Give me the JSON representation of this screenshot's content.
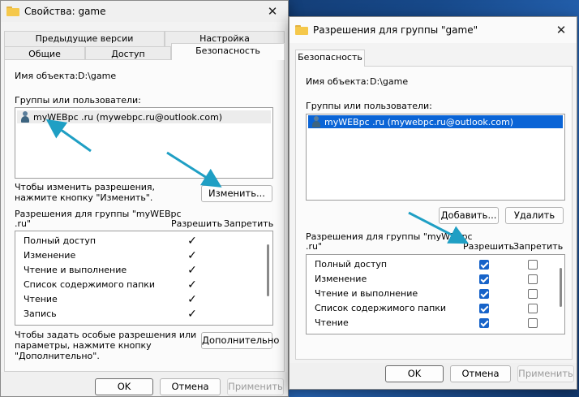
{
  "left_dialog": {
    "title": "Свойства: game",
    "tabs_top": [
      "Предыдущие версии",
      "Настройка"
    ],
    "tabs_bottom": [
      "Общие",
      "Доступ",
      "Безопасность"
    ],
    "object_name_label": "Имя объекта:",
    "object_name_value": "D:\\game",
    "groups_label": "Группы или пользователи:",
    "users": [
      "myWEBpc .ru (mywebpc.ru@outlook.com)"
    ],
    "change_hint_line1": "Чтобы изменить разрешения,",
    "change_hint_line2": "нажмите кнопку \"Изменить\".",
    "change_button": "Изменить...",
    "perm_for_line1": "Разрешения для группы \"myWEBpc",
    "perm_for_line2": ".ru\"",
    "allow_header": "Разрешить",
    "deny_header": "Запретить",
    "permissions": [
      {
        "name": "Полный доступ",
        "allow": true,
        "deny": false
      },
      {
        "name": "Изменение",
        "allow": true,
        "deny": false
      },
      {
        "name": "Чтение и выполнение",
        "allow": true,
        "deny": false
      },
      {
        "name": "Список содержимого папки",
        "allow": true,
        "deny": false
      },
      {
        "name": "Чтение",
        "allow": true,
        "deny": false
      },
      {
        "name": "Запись",
        "allow": true,
        "deny": false
      }
    ],
    "special_hint_line1": "Чтобы задать особые разрешения или",
    "special_hint_line2": "параметры, нажмите кнопку",
    "special_hint_line3": "\"Дополнительно\".",
    "advanced_button": "Дополнительно",
    "ok_button": "OK",
    "cancel_button": "Отмена",
    "apply_button": "Применить"
  },
  "right_dialog": {
    "title": "Разрешения для группы \"game\"",
    "tab": "Безопасность",
    "object_name_label": "Имя объекта:",
    "object_name_value": "D:\\game",
    "groups_label": "Группы или пользователи:",
    "users": [
      "myWEBpc .ru (mywebpc.ru@outlook.com)"
    ],
    "add_button": "Добавить...",
    "remove_button": "Удалить",
    "perm_for_line1": "Разрешения для группы \"myWEBpc",
    "perm_for_line2": ".ru\"",
    "allow_header": "Разрешить",
    "deny_header": "Запретить",
    "permissions": [
      {
        "name": "Полный доступ",
        "allow": true,
        "deny": false
      },
      {
        "name": "Изменение",
        "allow": true,
        "deny": false
      },
      {
        "name": "Чтение и выполнение",
        "allow": true,
        "deny": false
      },
      {
        "name": "Список содержимого папки",
        "allow": true,
        "deny": false
      },
      {
        "name": "Чтение",
        "allow": true,
        "deny": false
      }
    ],
    "ok_button": "OK",
    "cancel_button": "Отмена",
    "apply_button": "Применить"
  },
  "colors": {
    "arrow": "#1f9fc4",
    "selection": "#0a64d6",
    "checkbox": "#1763c9"
  },
  "icons": {
    "close": "close-icon",
    "folder": "folder-icon",
    "user": "user-icon",
    "arrow": "arrow-annotation-icon"
  }
}
